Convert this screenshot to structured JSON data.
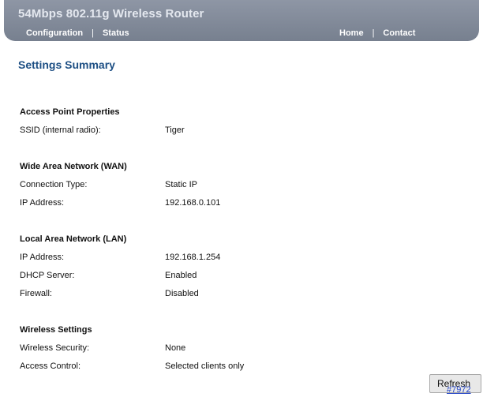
{
  "header": {
    "title": "54Mbps 802.11g Wireless Router",
    "nav_left": [
      "Configuration",
      "Status"
    ],
    "nav_right": [
      "Home",
      "Contact"
    ]
  },
  "page_title": "Settings Summary",
  "sections": [
    {
      "title": "Access Point Properties",
      "rows": [
        {
          "label": "SSID (internal radio):",
          "value": "Tiger"
        }
      ]
    },
    {
      "title": "Wide Area Network (WAN)",
      "rows": [
        {
          "label": "Connection Type:",
          "value": "Static IP"
        },
        {
          "label": "IP Address:",
          "value": "192.168.0.101"
        }
      ]
    },
    {
      "title": "Local Area Network (LAN)",
      "rows": [
        {
          "label": "IP Address:",
          "value": "192.168.1.254"
        },
        {
          "label": "DHCP Server:",
          "value": "Enabled"
        },
        {
          "label": "Firewall:",
          "value": "Disabled"
        }
      ]
    },
    {
      "title": "Wireless Settings",
      "rows": [
        {
          "label": "Wireless Security:",
          "value": "None"
        },
        {
          "label": "Access Control:",
          "value": "Selected clients only"
        }
      ]
    }
  ],
  "refresh_label": "Refresh",
  "watermark": "#7972"
}
